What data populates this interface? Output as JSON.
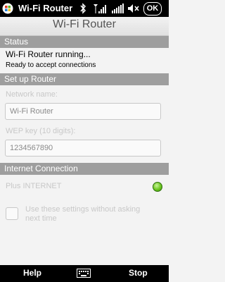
{
  "statusbar": {
    "app_name": "Wi-Fi Router",
    "ok_label": "OK",
    "icons": [
      "windows-logo-icon",
      "bluetooth-icon",
      "signal-icon",
      "wifi-signal-icon",
      "volume-mute-icon"
    ]
  },
  "title": "Wi-Fi Router",
  "status_section": {
    "header": "Status",
    "line1": "Wi-Fi Router running...",
    "line2": "Ready to accept connections"
  },
  "setup_section": {
    "header": "Set up Router",
    "network_label": "Network name:",
    "network_value": "Wi-Fi Router",
    "wep_label": "WEP key (10 digits):",
    "wep_value": "1234567890"
  },
  "internet_section": {
    "header": "Internet Connection",
    "plus_label": "Plus INTERNET",
    "plus_status_color": "#6cc620",
    "checkbox_label_line1": "Use these settings without asking",
    "checkbox_label_line2": "next time"
  },
  "softkeys": {
    "left": "Help",
    "right": "Stop",
    "center_icon": "keyboard-icon"
  }
}
